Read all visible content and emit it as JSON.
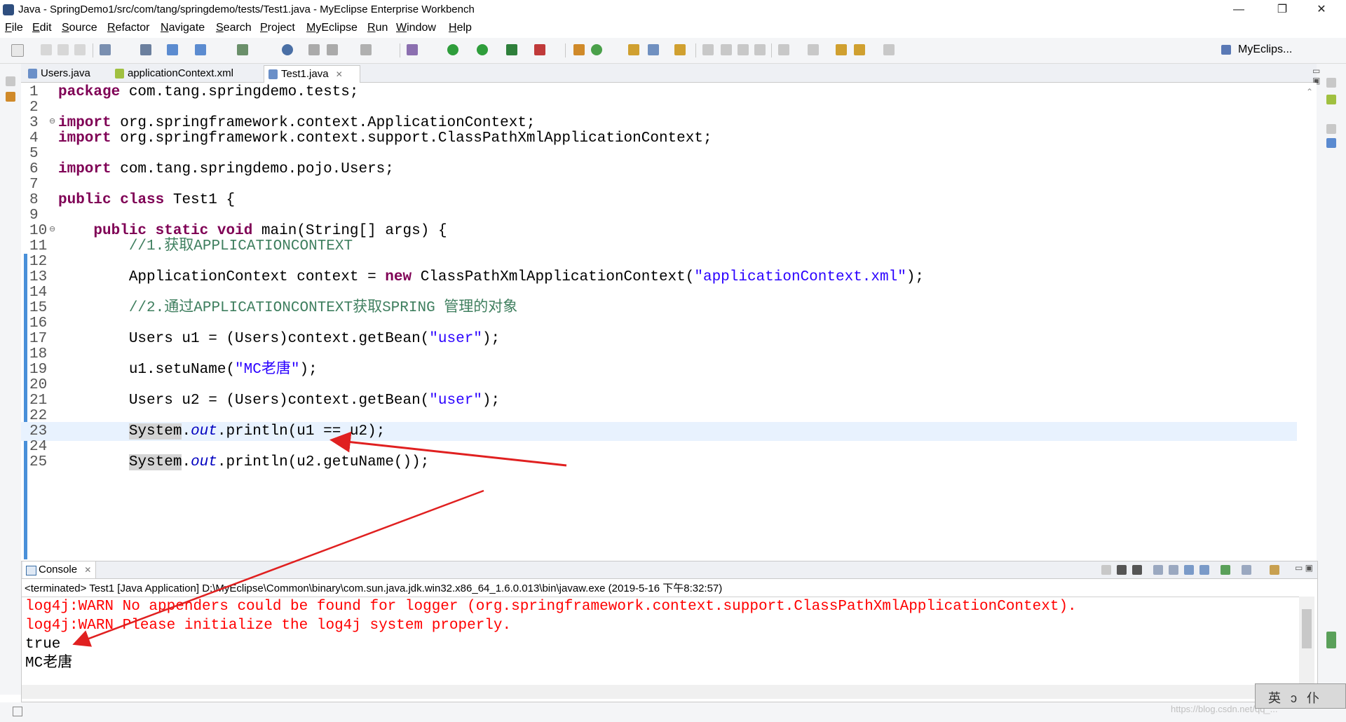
{
  "window": {
    "title": "Java - SpringDemo1/src/com/tang/springdemo/tests/Test1.java - MyEclipse Enterprise Workbench",
    "minimize": "—",
    "restore": "❐",
    "close": "✕"
  },
  "menu": [
    "File",
    "Edit",
    "Source",
    "Refactor",
    "Navigate",
    "Search",
    "Project",
    "MyEclipse",
    "Run",
    "Window",
    "Help"
  ],
  "toolbar": {
    "perspective_label": "MyEclips..."
  },
  "editor_tabs": [
    {
      "label": "Users.java",
      "active": false
    },
    {
      "label": "applicationContext.xml",
      "active": false
    },
    {
      "label": "Test1.java",
      "active": true
    }
  ],
  "code": {
    "n1": "1",
    "n2": "2",
    "n3": "3",
    "n4": "4",
    "n5": "5",
    "n6": "6",
    "n7": "7",
    "n8": "8",
    "n9": "9",
    "n10": "10",
    "n11": "11",
    "n12": "12",
    "n13": "13",
    "n14": "14",
    "n15": "15",
    "n16": "16",
    "n17": "17",
    "n18": "18",
    "n19": "19",
    "n20": "20",
    "n21": "21",
    "n22": "22",
    "n23": "23",
    "n24": "24",
    "n25": "25",
    "t1_kw": "package",
    "t1_rest": " com.tang.springdemo.tests;",
    "t3_kw": "import",
    "t3_rest": " org.springframework.context.ApplicationContext;",
    "t4_kw": "import",
    "t4_rest": " org.springframework.context.support.ClassPathXmlApplicationContext;",
    "t6_kw": "import",
    "t6_rest": " com.tang.springdemo.pojo.Users;",
    "t8_kw1": "public",
    "t8_sp": " ",
    "t8_kw2": "class",
    "t8_rest": " Test1 {",
    "t10_indent": "    ",
    "t10_kw1": "public",
    "t10_kw2": "static",
    "t10_kw3": "void",
    "t10_rest": " main(String[] args) {",
    "t11_indent": "        ",
    "t11_cm": "//1.获取APPLICATIONCONTEXT",
    "t13_pre": "        ApplicationContext context = ",
    "t13_kw": "new",
    "t13_mid": " ClassPathXmlApplicationContext(",
    "t13_str": "\"applicationContext.xml\"",
    "t13_end": ");",
    "t15_indent": "        ",
    "t15_cm": "//2.通过APPLICATIONCONTEXT获取SPRING 管理的对象",
    "t17_pre": "        Users u1 = (Users)context.getBean(",
    "t17_str": "\"user\"",
    "t17_end": ");",
    "t19_pre": "        u1.setuName(",
    "t19_str": "\"MC老唐\"",
    "t19_end": ");",
    "t21_pre": "        Users u2 = (Users)context.getBean(",
    "t21_str": "\"user\"",
    "t21_end": ");",
    "t23_indent": "        ",
    "t23_sys": "System",
    "t23_dot": ".",
    "t23_out": "out",
    "t23_rest": ".println(u1 == u2);",
    "t25_indent": "        ",
    "t25_sys": "System",
    "t25_dot": ".",
    "t25_out": "out",
    "t25_rest": ".println(u2.getuName());"
  },
  "console": {
    "tab_label": "Console",
    "status": "<terminated> Test1 [Java Application] D:\\MyEclipse\\Common\\binary\\com.sun.java.jdk.win32.x86_64_1.6.0.013\\bin\\javaw.exe (2019-5-16 下午8:32:57)",
    "lines": [
      "log4j:WARN No appenders could be found for logger (org.springframework.context.support.ClassPathXmlApplicationContext).",
      "log4j:WARN Please initialize the log4j system properly.",
      "true",
      "MC老唐"
    ]
  },
  "ime": {
    "text": "英ↄ仆"
  },
  "watermark": "https://blog.csdn.net/qq_..."
}
